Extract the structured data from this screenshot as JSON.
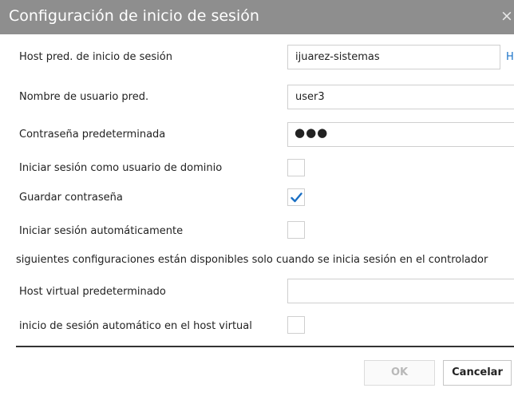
{
  "dialog": {
    "title": "Configuración de inicio de sesión",
    "close_glyph": "×"
  },
  "fields": {
    "host_label": "Host pred. de inicio de sesión",
    "host_value": "ijuarez-sistemas",
    "host_link": "Host local",
    "user_label": "Nombre de usuario pred.",
    "user_value": "user3",
    "password_label": "Contraseña predeterminada",
    "password_mask": "●●●",
    "domain_label": "Iniciar sesión como usuario de dominio",
    "save_password_label": "Guardar contraseña",
    "auto_login_label": "Iniciar sesión automáticamente",
    "note": "siguientes configuraciones están disponibles solo cuando se inicia sesión en el controlador",
    "virtual_host_label": "Host virtual predeterminado",
    "virtual_host_value": "",
    "virtual_auto_label": "inicio de sesión automático en el host virtual"
  },
  "checkboxes": {
    "domain_user": false,
    "save_password": true,
    "auto_login": false,
    "virtual_auto_login": false
  },
  "buttons": {
    "ok": "OK",
    "cancel": "Cancelar"
  },
  "colors": {
    "titlebar": "#8e8e8e",
    "link": "#1a73c8",
    "check": "#1a6fc4"
  },
  "icons": {
    "close": "close-icon",
    "check": "checkmark-icon"
  }
}
